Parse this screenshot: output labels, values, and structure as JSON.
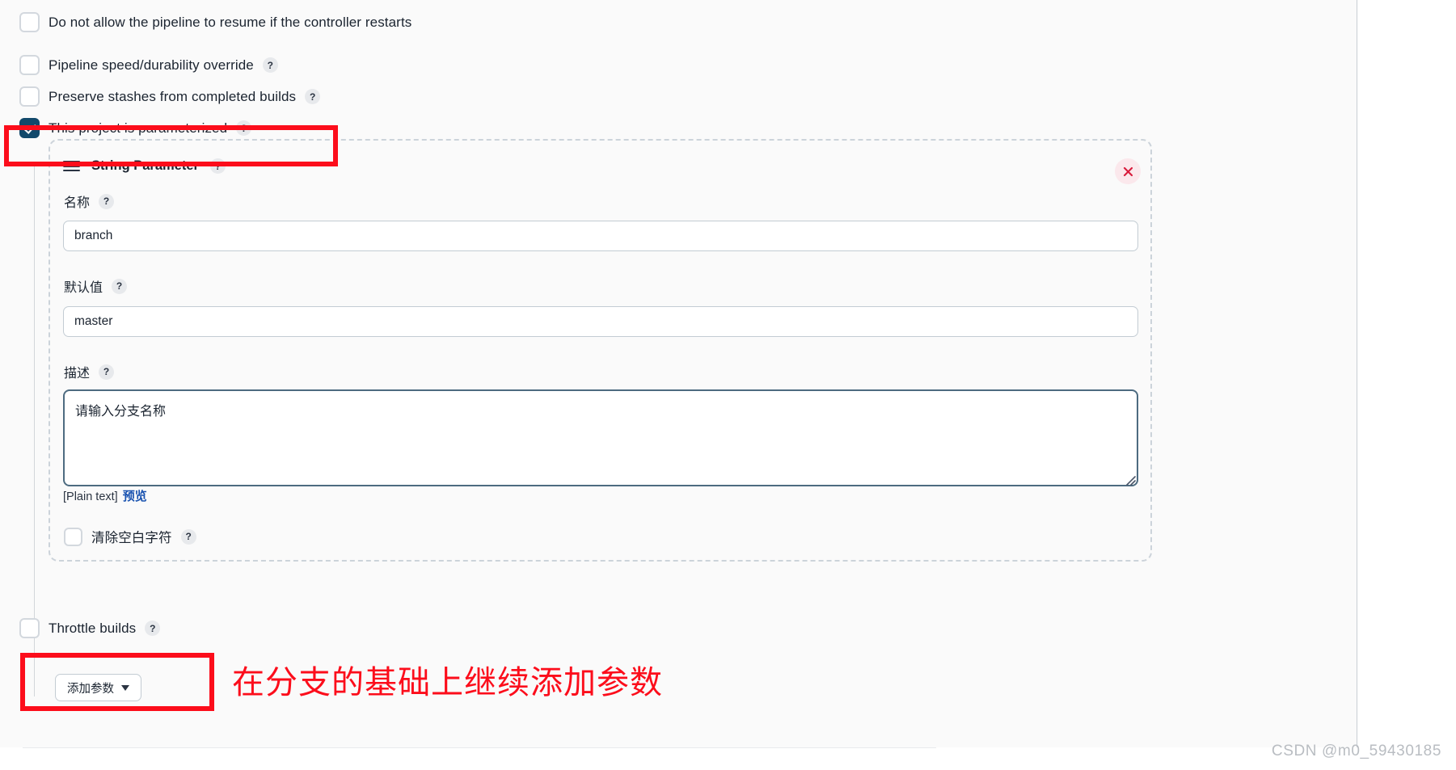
{
  "options": [
    {
      "label": "Do not allow the pipeline to resume if the controller restarts",
      "checked": false,
      "help": false
    },
    {
      "label": "Pipeline speed/durability override",
      "checked": false,
      "help": true
    },
    {
      "label": "Preserve stashes from completed builds",
      "checked": false,
      "help": true
    },
    {
      "label": "This project is parameterized",
      "checked": true,
      "help": true
    }
  ],
  "parameter_card": {
    "title": "String Parameter",
    "help_glyph": "?",
    "close_label": "×",
    "name_field": {
      "label": "名称",
      "value": "branch"
    },
    "default_field": {
      "label": "默认值",
      "value": "master"
    },
    "description_field": {
      "label": "描述",
      "value": "请输入分支名称"
    },
    "markup_note": "[Plain text]",
    "preview_link": "预览",
    "trim_checkbox": {
      "label": "清除空白字符",
      "checked": false
    }
  },
  "add_parameter_button": {
    "label": "添加参数"
  },
  "throttle_row": {
    "label": "Throttle builds",
    "checked": false
  },
  "annotation": {
    "note": "在分支的基础上继续添加参数",
    "color": "#fc0d1b"
  },
  "watermark": "CSDN @m0_59430185",
  "theme": {
    "accent_checked": "#12496b",
    "link_blue": "#1a53b0",
    "close_red": "#d81b3c",
    "dashed_border": "#ccd3da",
    "page_bg": "#fafafa"
  }
}
